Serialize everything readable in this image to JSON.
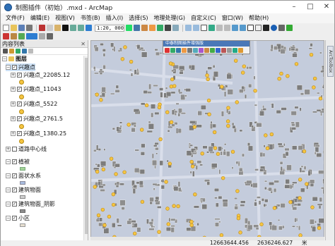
{
  "window": {
    "title": "制图插件（初始）.mxd - ArcMap",
    "controls": [
      "–",
      "□",
      "✕"
    ]
  },
  "menu": [
    "文件(F)",
    "编辑(E)",
    "视图(V)",
    "书签(B)",
    "插入(I)",
    "选择(S)",
    "地理处理(G)",
    "自定义(C)",
    "窗口(W)",
    "帮助(H)"
  ],
  "toolbar": {
    "scale": "1:20, 000"
  },
  "toc": {
    "title": "内容列表",
    "close": "✕",
    "layers_root": "图层",
    "groups": [
      {
        "label": "兴趣点",
        "checked": true,
        "expanded": true
      },
      {
        "label": "兴趣点_22085.12",
        "checked": true
      },
      {
        "label": "兴趣点_11043",
        "checked": true
      },
      {
        "label": "兴趣点_5522",
        "checked": true
      },
      {
        "label": "兴趣点_2761.5",
        "checked": true
      },
      {
        "label": "兴趣点_1380.25",
        "checked": true
      },
      {
        "label": "道路中心线",
        "checked": false
      },
      {
        "label": "植被",
        "checked": true
      },
      {
        "label": "面状水系",
        "checked": true
      },
      {
        "label": "建筑物面",
        "checked": true
      },
      {
        "label": "建筑物面_阴影",
        "checked": true
      },
      {
        "label": "小区",
        "checked": true
      }
    ]
  },
  "floating_toolbar": {
    "title": "中泰制图插件增强版"
  },
  "side_panel": {
    "tab": "ArcToolbox"
  },
  "status": {
    "x": "12663644.456",
    "y": "2636246.627",
    "unit": "米"
  },
  "colors": {
    "map_background": "#c4ccdc",
    "building": "#8e8e8e",
    "poi": "#f5c542",
    "water": "#a9bde0"
  }
}
